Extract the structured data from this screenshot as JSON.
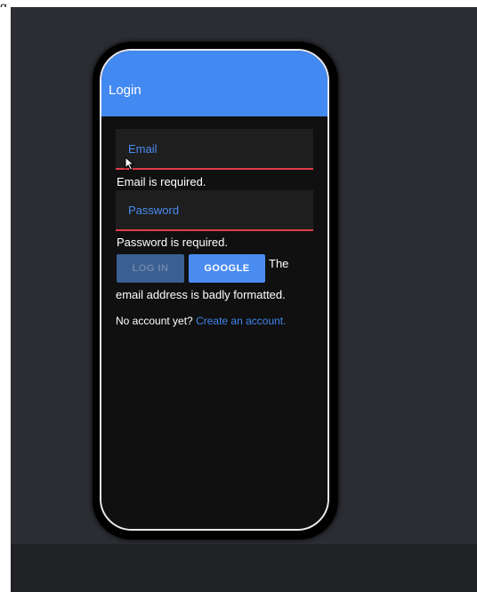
{
  "screen": {
    "title": "Login",
    "email_placeholder": "Email",
    "password_placeholder": "Password",
    "email_error": "Email is required.",
    "password_error": "Password is required.",
    "login_button": "LOG IN",
    "google_button": "GOOGLE",
    "auth_error_line1": "The",
    "auth_error_line2": "email address is badly formatted.",
    "signup_prompt": "No account yet?",
    "signup_link": "Create an account."
  },
  "colors": {
    "toolbar": "#4389f2",
    "error_underline": "#e03a48",
    "link": "#3f86ee"
  },
  "icons": {
    "cursor": "mouse-cursor-icon"
  }
}
